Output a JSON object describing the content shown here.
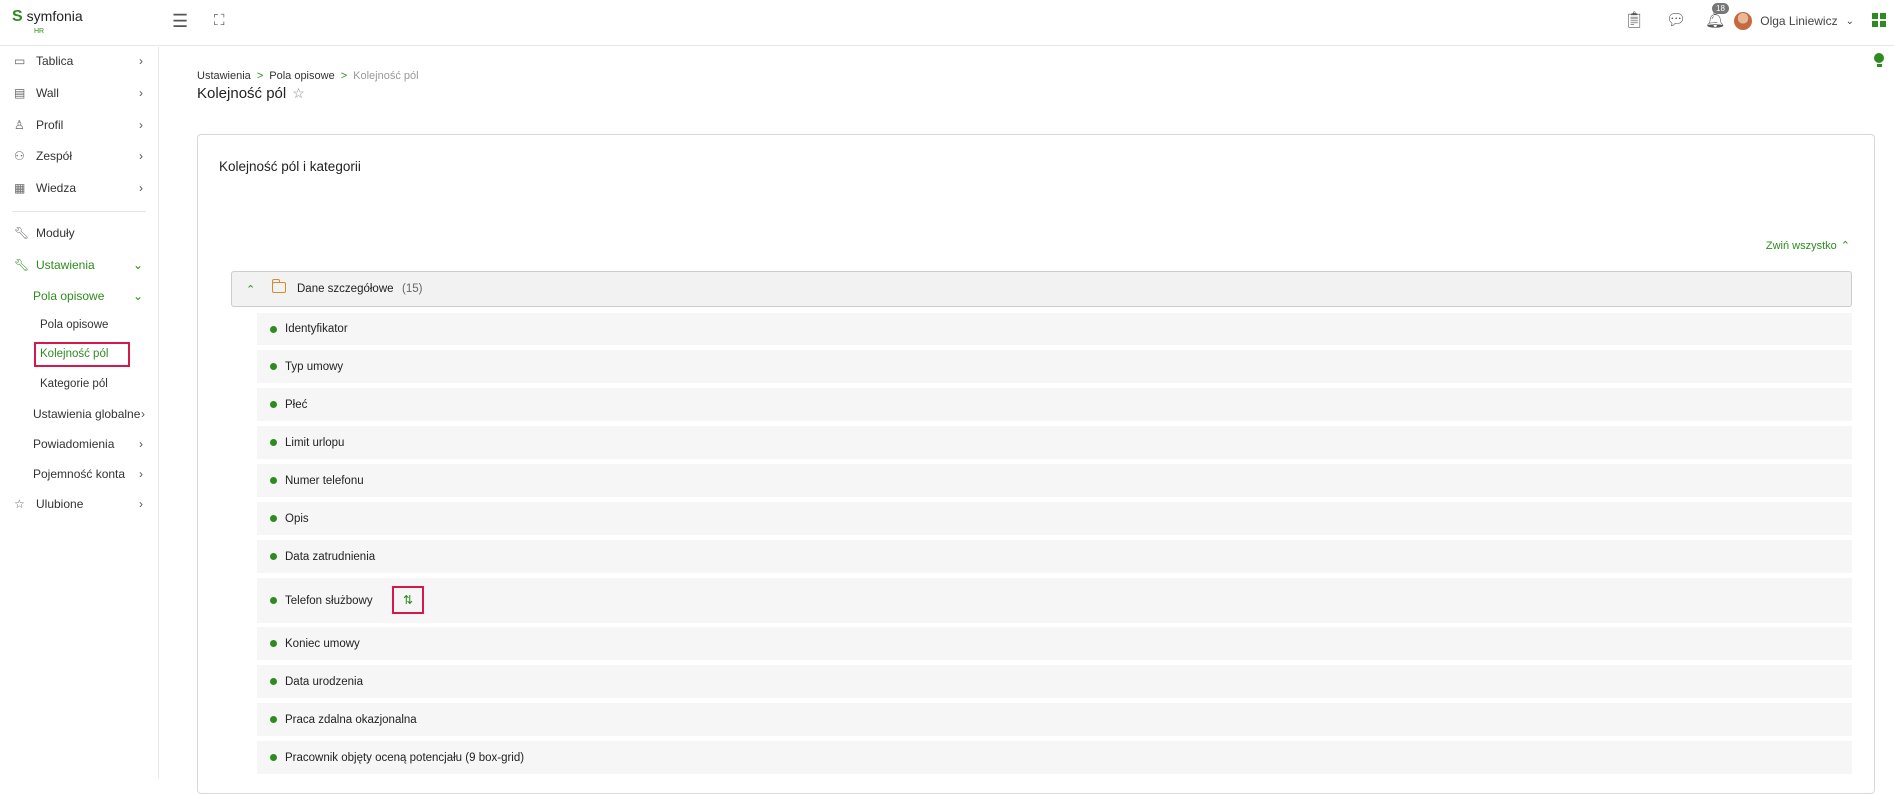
{
  "app": {
    "logo_mark": "S",
    "logo_name": "symfonia",
    "logo_sub": "HR"
  },
  "topbar": {
    "notifications_count": "18",
    "user_name": "Olga Liniewicz"
  },
  "sidebar": {
    "items": [
      {
        "label": "Tablica",
        "icon": "monitor-icon"
      },
      {
        "label": "Wall",
        "icon": "wall-icon"
      },
      {
        "label": "Profil",
        "icon": "user-icon"
      },
      {
        "label": "Zespół",
        "icon": "team-icon"
      },
      {
        "label": "Wiedza",
        "icon": "document-icon"
      },
      {
        "label": "Moduły",
        "icon": "wrench-icon"
      },
      {
        "label": "Ustawienia",
        "icon": "wrench-icon"
      }
    ],
    "settings_sub": {
      "pola_opisowe": "Pola opisowe",
      "pola_children": [
        "Pola opisowe",
        "Kolejność pól",
        "Kategorie pól"
      ],
      "ustawienia_globalne": "Ustawienia globalne",
      "powiadomienia": "Powiadomienia",
      "pojemnosc": "Pojemność konta"
    },
    "ulubione": "Ulubione"
  },
  "breadcrumb": [
    "Ustawienia",
    "Pola opisowe",
    "Kolejność pól"
  ],
  "page_title": "Kolejność pól",
  "card": {
    "title": "Kolejność pól i kategorii",
    "collapse_all": "Zwiń wszystko",
    "group": {
      "name": "Dane szczegółowe",
      "count": "(15)"
    },
    "fields": [
      "Identyfikator",
      "Typ umowy",
      "Płeć",
      "Limit urlopu",
      "Numer telefonu",
      "Opis",
      "Data zatrudnienia",
      "Telefon służbowy",
      "Koniec umowy",
      "Data urodzenia",
      "Praca zdalna okazjonalna",
      "Pracownik objęty oceną potencjału (9 box-grid)"
    ]
  }
}
